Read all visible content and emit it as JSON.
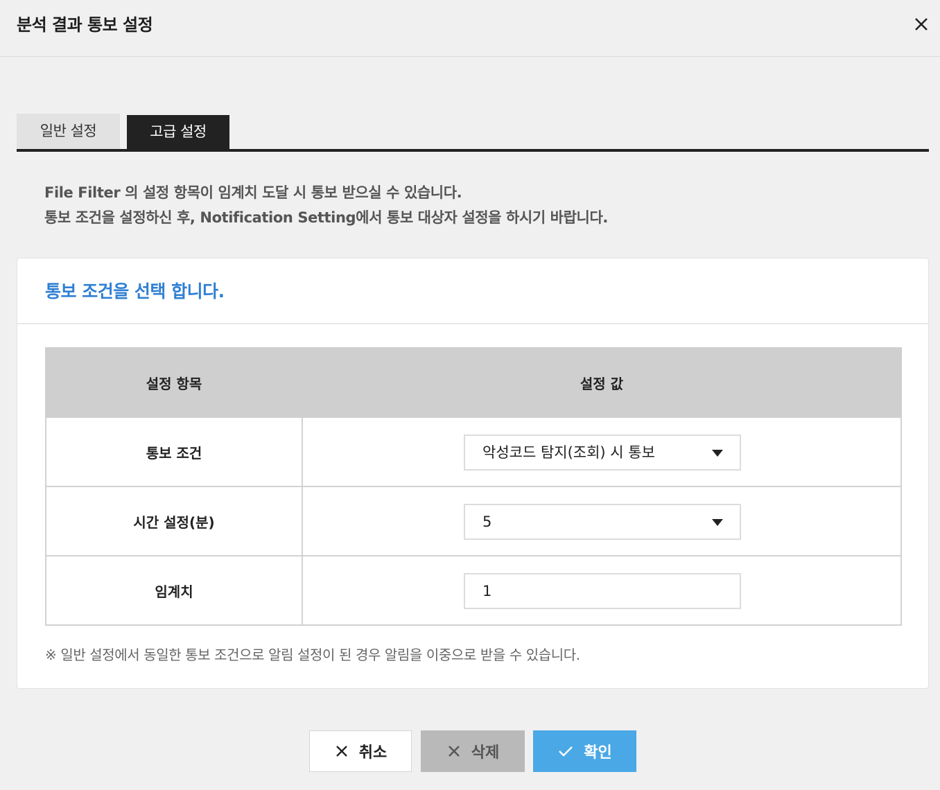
{
  "dialog": {
    "title": "분석 결과 통보 설정"
  },
  "tabs": [
    {
      "label": "일반 설정",
      "active": false
    },
    {
      "label": "고급 설정",
      "active": true
    }
  ],
  "description": {
    "line1": "File Filter 의 설정 항목이 임계치 도달 시 통보 받으실 수 있습니다.",
    "line2": "통보 조건을 설정하신 후, Notification Setting에서 통보 대상자 설정을 하시기 바랍니다."
  },
  "panel": {
    "heading": "통보 조건을 선택 합니다.",
    "table": {
      "headers": [
        "설정 항목",
        "설정 값"
      ],
      "rows": [
        {
          "label": "통보 조건",
          "value": "악성코드 탐지(조회) 시 통보",
          "control": "select"
        },
        {
          "label": "시간 설정(분)",
          "value": "5",
          "control": "select"
        },
        {
          "label": "임계치",
          "value": "1",
          "control": "input"
        }
      ]
    },
    "note": "※ 일반 설정에서 동일한 통보 조건으로 알림 설정이 된 경우 알림을 이중으로 받을 수 있습니다."
  },
  "buttons": {
    "cancel": "취소",
    "delete": "삭제",
    "confirm": "확인"
  },
  "icons": {
    "close": "close-icon",
    "cancel": "x-icon",
    "delete": "x-icon",
    "confirm": "check-icon",
    "dropdown": "caret-down-icon"
  },
  "colors": {
    "accent_blue": "#2f7fd3",
    "confirm_button": "#4aa8e6",
    "delete_button": "#b9b9b9",
    "active_tab": "#222222",
    "table_header": "#cfcfcf"
  }
}
